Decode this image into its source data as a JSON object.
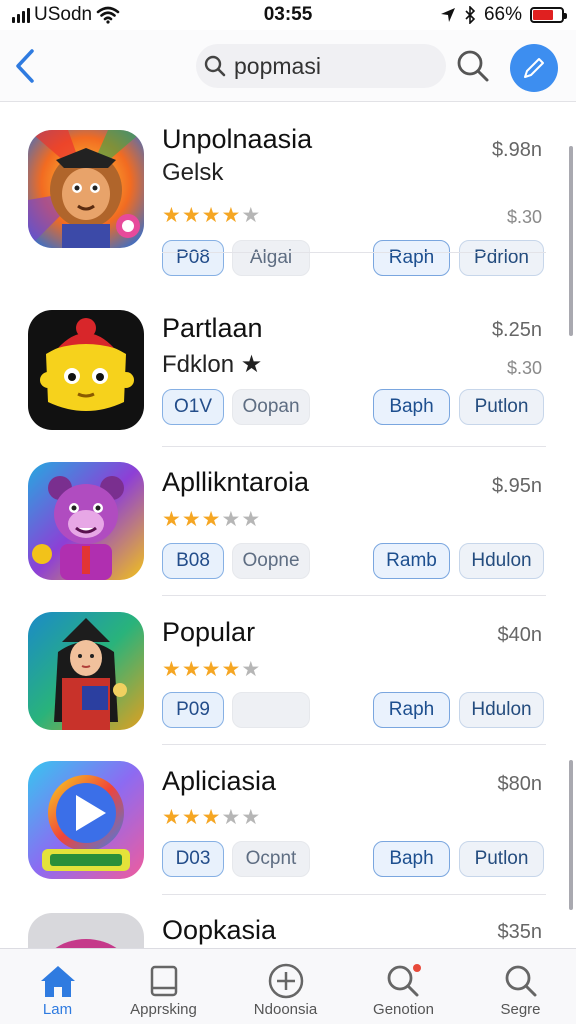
{
  "status_bar": {
    "carrier": "USodn",
    "time": "03:55",
    "battery_percent": "66%",
    "battery_level": 0.7,
    "icons": [
      "signal-bars",
      "wifi-icon",
      "location-arrow-icon",
      "bluetooth-icon",
      "battery-icon"
    ]
  },
  "nav": {
    "search_value": "popmasi",
    "icons": [
      "chevron-left-icon",
      "search-icon",
      "compose-icon"
    ]
  },
  "apps": [
    {
      "name": "Unpolnaasia",
      "subtitle": "Gelsk",
      "price": "$.98n",
      "price2": "$.30",
      "rating": 4,
      "tags": [
        "P08",
        "Algai"
      ],
      "actions": [
        "Raph",
        "Pdrlon"
      ],
      "icon": "lion-character-icon"
    },
    {
      "name": "Partlaan",
      "subtitle": "Fdklon ★",
      "price": "$.25n",
      "price2": "$.30",
      "rating": null,
      "tags": [
        "O1V",
        "Oopan"
      ],
      "actions": [
        "Baph",
        "Putlon"
      ],
      "icon": "yellow-cube-character-icon"
    },
    {
      "name": "Apllikntaroia",
      "subtitle": "",
      "price": "$.95n",
      "price2": "",
      "rating": 3,
      "tags": [
        "B08",
        "Oopne"
      ],
      "actions": [
        "Ramb",
        "Hdulon"
      ],
      "icon": "purple-bear-character-icon"
    },
    {
      "name": "Popular",
      "subtitle": "",
      "price": "$40n",
      "price2": "",
      "rating": 4,
      "tags": [
        "P09",
        ""
      ],
      "actions": [
        "Raph",
        "Hdulon"
      ],
      "icon": "warrior-girl-icon"
    },
    {
      "name": "Apliciasia",
      "subtitle": "",
      "price": "$80n",
      "price2": "",
      "rating": 3,
      "tags": [
        "D03",
        "Ocpnt"
      ],
      "actions": [
        "Baph",
        "Putlon"
      ],
      "icon": "play-button-icon"
    },
    {
      "name": "Oopkasia",
      "subtitle": "",
      "price": "$35n",
      "price2": "",
      "rating": null,
      "tags": [],
      "actions": [],
      "icon": "partial-app-icon"
    }
  ],
  "tabs": [
    {
      "label": "Lam",
      "icon": "home-icon",
      "active": true
    },
    {
      "label": "Apprsking",
      "icon": "book-icon",
      "active": false
    },
    {
      "label": "Ndoonsia",
      "icon": "add-circle-icon",
      "active": false
    },
    {
      "label": "Genotion",
      "icon": "search-badge-icon",
      "active": false
    },
    {
      "label": "Segre",
      "icon": "search-icon",
      "active": false
    }
  ],
  "colors": {
    "accent": "#3d8ef0",
    "star": "#f5a623",
    "battery_low": "#e02020"
  }
}
